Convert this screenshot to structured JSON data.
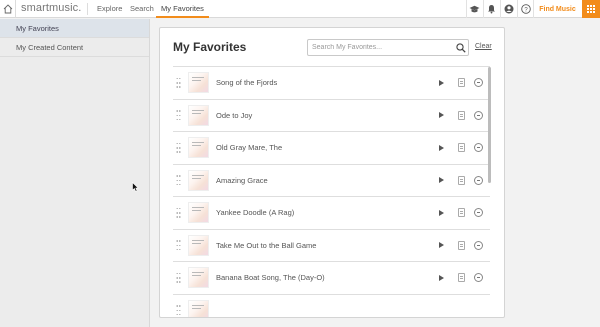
{
  "topbar": {
    "logo": "smartmusic.",
    "nav": {
      "explore": "Explore",
      "search": "Search",
      "favorites": "My Favorites"
    },
    "icons": [
      "home-icon",
      "graduation-cap-icon",
      "bell-icon",
      "user-icon",
      "help-icon",
      "apps-grid-icon"
    ],
    "find_music": "Find Music"
  },
  "sidebar": {
    "items": [
      {
        "label": "My Favorites"
      },
      {
        "label": "My Created Content"
      }
    ]
  },
  "main": {
    "title": "My Favorites",
    "search": {
      "placeholder": "Search My Favorites...",
      "value": ""
    },
    "clear_label": "Clear",
    "items": [
      {
        "title": "Song of the Fjords"
      },
      {
        "title": "Ode to Joy"
      },
      {
        "title": "Old Gray Mare, The"
      },
      {
        "title": "Amazing Grace"
      },
      {
        "title": "Yankee Doodle (A Rag)"
      },
      {
        "title": "Take Me Out to the Ball Game"
      },
      {
        "title": "Banana Boat Song, The (Day-O)"
      },
      {
        "title": ""
      }
    ]
  },
  "colors": {
    "accent": "#f28c1b",
    "sidebar_active": "#dde3ea",
    "background": "#f2f2f2"
  }
}
